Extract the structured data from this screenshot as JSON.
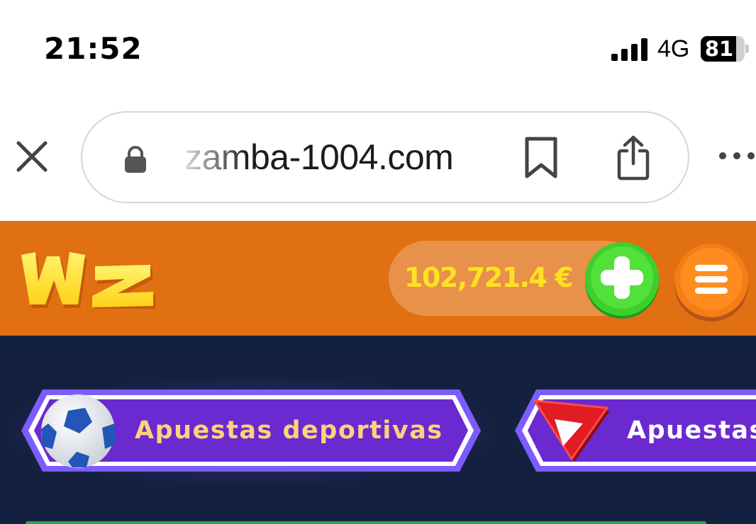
{
  "status_bar": {
    "time": "21:52",
    "network": "4G",
    "battery_percent": "81",
    "battery_level": 0.81,
    "icons": [
      "signal-icon",
      "battery-icon"
    ]
  },
  "browser": {
    "url": "zamba-1004.com",
    "icons": [
      "close-icon",
      "lock-icon",
      "bookmark-icon",
      "share-icon",
      "more-icon"
    ]
  },
  "site_header": {
    "logo_text": "Wz",
    "balance": "102,721.4 €",
    "icons": [
      "plus-icon",
      "menu-icon"
    ],
    "colors": {
      "header_bg": "#e07011",
      "balance_text": "#ffe21f",
      "plus_button": "#3fcf2c",
      "menu_button": "#f47d16"
    }
  },
  "categories": [
    {
      "label": "Apuestas deportivas",
      "icon": "soccer-ball-icon"
    },
    {
      "label": "Apuestas",
      "icon": "play-icon"
    }
  ],
  "colors": {
    "page_bg": "#14203f",
    "tab_bg": "#6a2ad0",
    "tab_border": "#7c5cff",
    "sports_label": "#ffd27a"
  }
}
